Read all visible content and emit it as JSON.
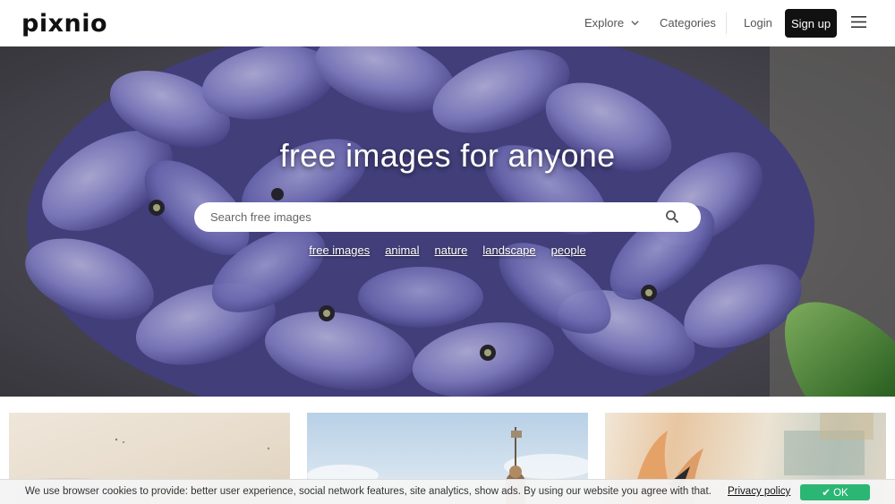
{
  "header": {
    "logo": "pixnio",
    "nav": {
      "explore": "Explore",
      "categories": "Categories",
      "login": "Login",
      "signup": "Sign up"
    }
  },
  "hero": {
    "title": "free images for anyone",
    "search": {
      "placeholder": "Search free images"
    },
    "tags": [
      "free images",
      "animal",
      "nature",
      "landscape",
      "people"
    ]
  },
  "cookie": {
    "text": "We use browser cookies to provide: better user experience, social network features, site analytics, show ads. By using our website you agree with that.",
    "privacy_link": "Privacy policy",
    "ok_label": "✔ OK"
  },
  "colors": {
    "header_bg": "#ffffff",
    "signup_bg": "#111111",
    "ok_bg": "#2bb673",
    "hero_flower": "#8c8ad0"
  },
  "icons": {
    "explore_chevron": "chevron-down-icon",
    "menu": "hamburger-menu-icon",
    "search": "search-icon"
  }
}
